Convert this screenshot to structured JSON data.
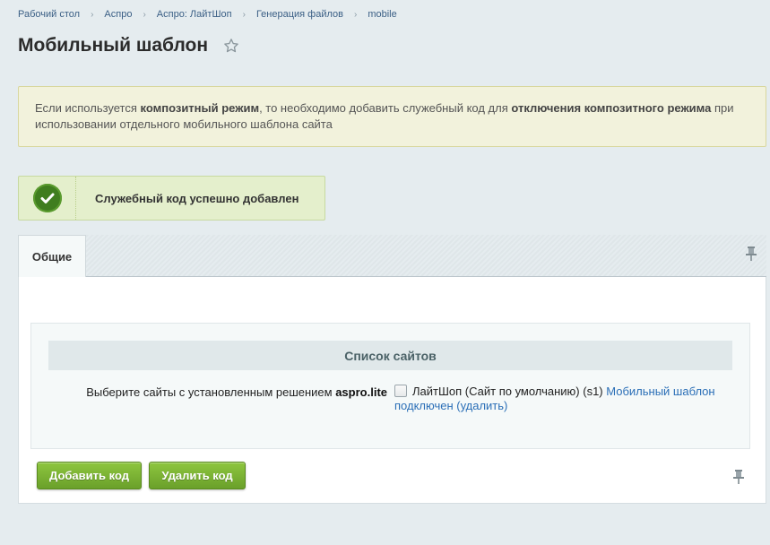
{
  "breadcrumb": {
    "items": [
      "Рабочий стол",
      "Аспро",
      "Аспро: ЛайтШоп",
      "Генерация файлов",
      "mobile"
    ],
    "separator": "›"
  },
  "page": {
    "title": "Мобильный шаблон"
  },
  "notice": {
    "part1": "Если используется ",
    "bold1": "композитный режим",
    "part2": ", то необходимо добавить служебный код для ",
    "bold2": "отключения композитного режима",
    "part3": " при использовании отдельного мобильного шаблона сайта"
  },
  "success": {
    "message": "Служебный код успешно добавлен",
    "icon": "check-circle-icon",
    "color": "#3f7d1f"
  },
  "tabs": [
    {
      "label": "Общие",
      "active": true
    }
  ],
  "sites_section": {
    "heading": "Список сайтов",
    "label_prefix": "Выберите сайты с установленным решением ",
    "label_solution": "aspro.lite",
    "site_name": "ЛайтШоп (Сайт по умолчанию) (s1)",
    "site_checked": false,
    "status_link": "Мобильный шаблон подключен (удалить)"
  },
  "buttons": {
    "add": "Добавить код",
    "delete": "Удалить код"
  },
  "colors": {
    "background": "#e5ecef",
    "accent_green": "#7ab434",
    "link": "#2b6fb7"
  }
}
